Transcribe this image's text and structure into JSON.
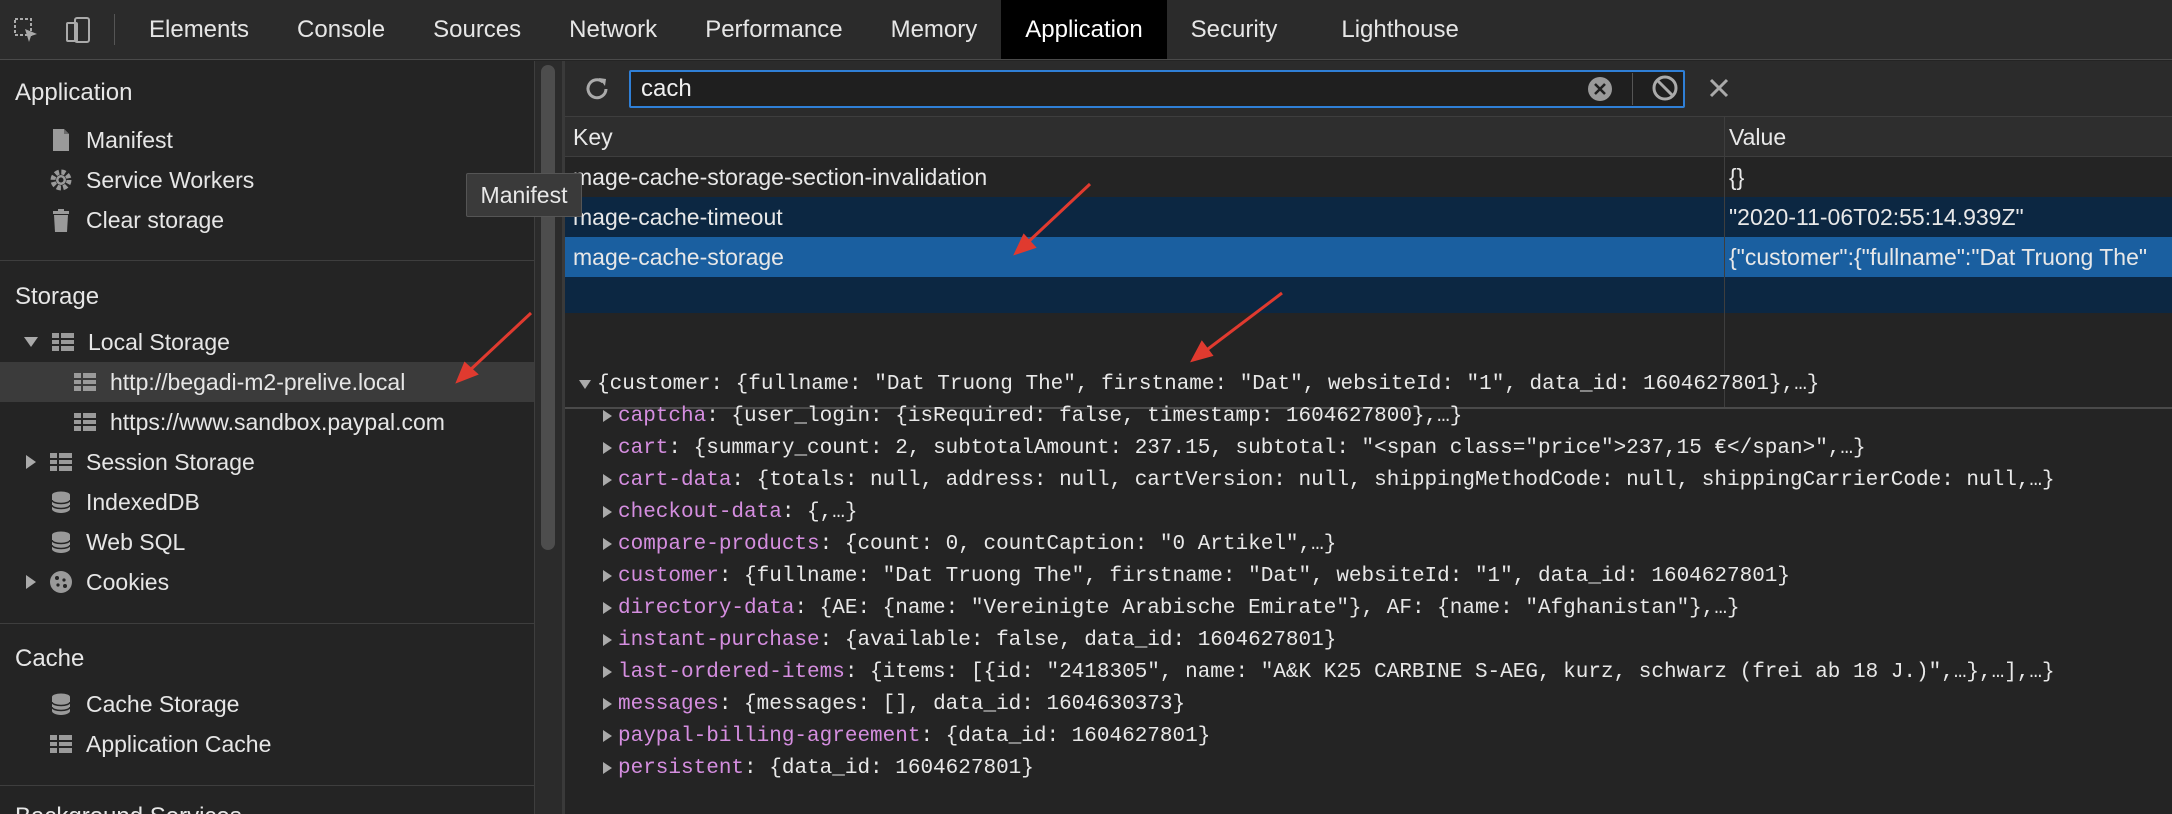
{
  "tabs": [
    "Elements",
    "Console",
    "Sources",
    "Network",
    "Performance",
    "Memory",
    "Application",
    "Security",
    "Lighthouse"
  ],
  "active_tab": "Application",
  "sidebar": {
    "application_header": "Application",
    "application_items": [
      "Manifest",
      "Service Workers",
      "Clear storage"
    ],
    "storage_header": "Storage",
    "local_storage": "Local Storage",
    "local_storage_items": [
      "http://begadi-m2-prelive.local",
      "https://www.sandbox.paypal.com"
    ],
    "storage_items": [
      "Session Storage",
      "IndexedDB",
      "Web SQL",
      "Cookies"
    ],
    "cache_header": "Cache",
    "cache_items": [
      "Cache Storage",
      "Application Cache"
    ],
    "bottom_header": "Background Services"
  },
  "tooltip": "Manifest",
  "filter": {
    "value": "cach"
  },
  "table": {
    "headers": {
      "key": "Key",
      "value": "Value"
    },
    "rows": [
      {
        "key": "mage-cache-storage-section-invalidation",
        "value": "{}"
      },
      {
        "key": "mage-cache-timeout",
        "value": "\"2020-11-06T02:55:14.939Z\""
      },
      {
        "key": "mage-cache-storage",
        "value": "{\"customer\":{\"fullname\":\"Dat Truong The\""
      }
    ]
  },
  "tree": {
    "root": "{customer: {fullname: \"Dat Truong The\", firstname: \"Dat\", websiteId: \"1\", data_id: 1604627801},…}",
    "children": [
      {
        "key": "captcha",
        "value": ": {user_login: {isRequired: false, timestamp: 1604627800},…}"
      },
      {
        "key": "cart",
        "value": ": {summary_count: 2, subtotalAmount: 237.15, subtotal: \"<span class=\"price\">237,15 €</span>\",…}"
      },
      {
        "key": "cart-data",
        "value": ": {totals: null, address: null, cartVersion: null, shippingMethodCode: null, shippingCarrierCode: null,…}"
      },
      {
        "key": "checkout-data",
        "value": ": {,…}"
      },
      {
        "key": "compare-products",
        "value": ": {count: 0, countCaption: \"0 Artikel\",…}"
      },
      {
        "key": "customer",
        "value": ": {fullname: \"Dat Truong The\", firstname: \"Dat\", websiteId: \"1\", data_id: 1604627801}"
      },
      {
        "key": "directory-data",
        "value": ": {AE: {name: \"Vereinigte Arabische Emirate\"}, AF: {name: \"Afghanistan\"},…}"
      },
      {
        "key": "instant-purchase",
        "value": ": {available: false, data_id: 1604627801}"
      },
      {
        "key": "last-ordered-items",
        "value": ": {items: [{id: \"2418305\", name: \"A&K K25 CARBINE S-AEG, kurz, schwarz (frei ab 18 J.)\",…},…],…}"
      },
      {
        "key": "messages",
        "value": ": {messages: [], data_id: 1604630373}"
      },
      {
        "key": "paypal-billing-agreement",
        "value": ": {data_id: 1604627801}"
      },
      {
        "key": "persistent",
        "value": ": {data_id: 1604627801}"
      }
    ]
  },
  "colors": {
    "accent": "#2f7fd6",
    "selected_row": "#1a5fa0",
    "alt_row": "#0c2742",
    "key_color": "#d58ee0",
    "arrow": "#e03a2f"
  }
}
